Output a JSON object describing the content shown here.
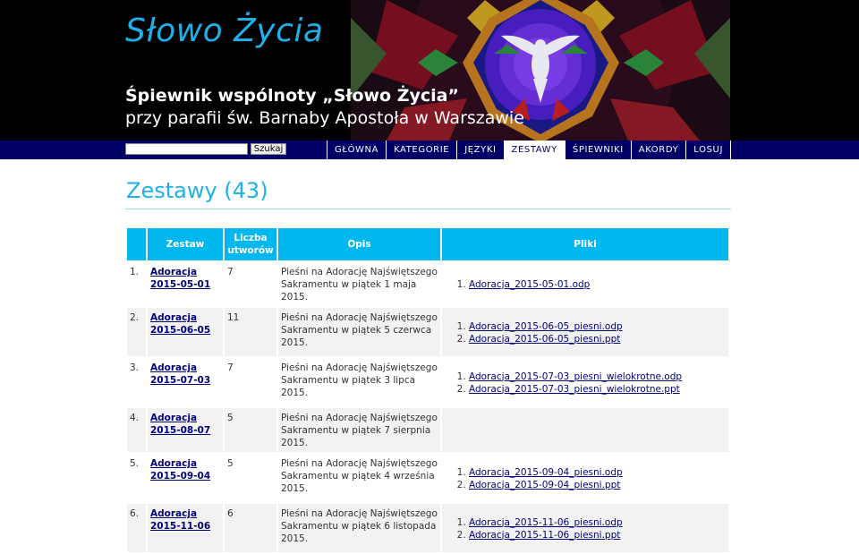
{
  "header": {
    "site_title": "Słowo Życia",
    "subtitle_line1": "Śpiewnik wspólnoty „Słowo Życia”",
    "subtitle_line2": "przy parafii św. Barnaby Apostoła w Warszawie"
  },
  "search": {
    "placeholder": "",
    "button_label": "Szukaj"
  },
  "nav": {
    "items": [
      {
        "label": "GŁÓWNA",
        "active": false
      },
      {
        "label": "KATEGORIE",
        "active": false
      },
      {
        "label": "JĘZYKI",
        "active": false
      },
      {
        "label": "ZESTAWY",
        "active": true
      },
      {
        "label": "ŚPIEWNIKI",
        "active": false
      },
      {
        "label": "AKORDY",
        "active": false
      },
      {
        "label": "LOSUJ",
        "active": false
      }
    ]
  },
  "page": {
    "heading": "Zestawy (43)"
  },
  "table": {
    "headers": {
      "zestaw": "Zestaw",
      "liczba_1": "Liczba",
      "liczba_2": "utworów",
      "opis": "Opis",
      "pliki": "Pliki"
    },
    "rows": [
      {
        "num": "1.",
        "zestaw_1": "Adoracja",
        "zestaw_2": "2015-05-01",
        "liczba": "7",
        "opis": "Pieśni na Adorację Najświętszego Sakramentu w piątek 1 maja 2015.",
        "pliki": [
          "Adoracja_2015-05-01.odp"
        ]
      },
      {
        "num": "2.",
        "zestaw_1": "Adoracja",
        "zestaw_2": "2015-06-05",
        "liczba": "11",
        "opis": "Pieśni na Adorację Najświętszego Sakramentu w piątek 5 czerwca 2015.",
        "pliki": [
          "Adoracja_2015-06-05_piesni.odp",
          "Adoracja_2015-06-05_piesni.ppt"
        ]
      },
      {
        "num": "3.",
        "zestaw_1": "Adoracja",
        "zestaw_2": "2015-07-03",
        "liczba": "7",
        "opis": "Pieśni na Adorację Najświętszego Sakramentu w piątek 3 lipca 2015.",
        "pliki": [
          "Adoracja_2015-07-03_piesni_wielokrotne.odp",
          "Adoracja_2015-07-03_piesni_wielokrotne.ppt"
        ]
      },
      {
        "num": "4.",
        "zestaw_1": "Adoracja",
        "zestaw_2": "2015-08-07",
        "liczba": "5",
        "opis": "Pieśni na Adorację Najświętszego Sakramentu w piątek 7 sierpnia 2015.",
        "pliki": []
      },
      {
        "num": "5.",
        "zestaw_1": "Adoracja",
        "zestaw_2": "2015-09-04",
        "liczba": "5",
        "opis": "Pieśni na Adorację Najświętszego Sakramentu w piątek 4 września 2015.",
        "pliki": [
          "Adoracja_2015-09-04_piesni.odp",
          "Adoracja_2015-09-04_piesni.ppt"
        ]
      },
      {
        "num": "6.",
        "zestaw_1": "Adoracja",
        "zestaw_2": "2015-11-06",
        "liczba": "6",
        "opis": "Pieśni na Adorację Najświętszego Sakramentu w piątek 6 listopada 2015.",
        "pliki": [
          "Adoracja_2015-11-06_piesni.odp",
          "Adoracja_2015-11-06_piesni.ppt"
        ]
      }
    ]
  }
}
